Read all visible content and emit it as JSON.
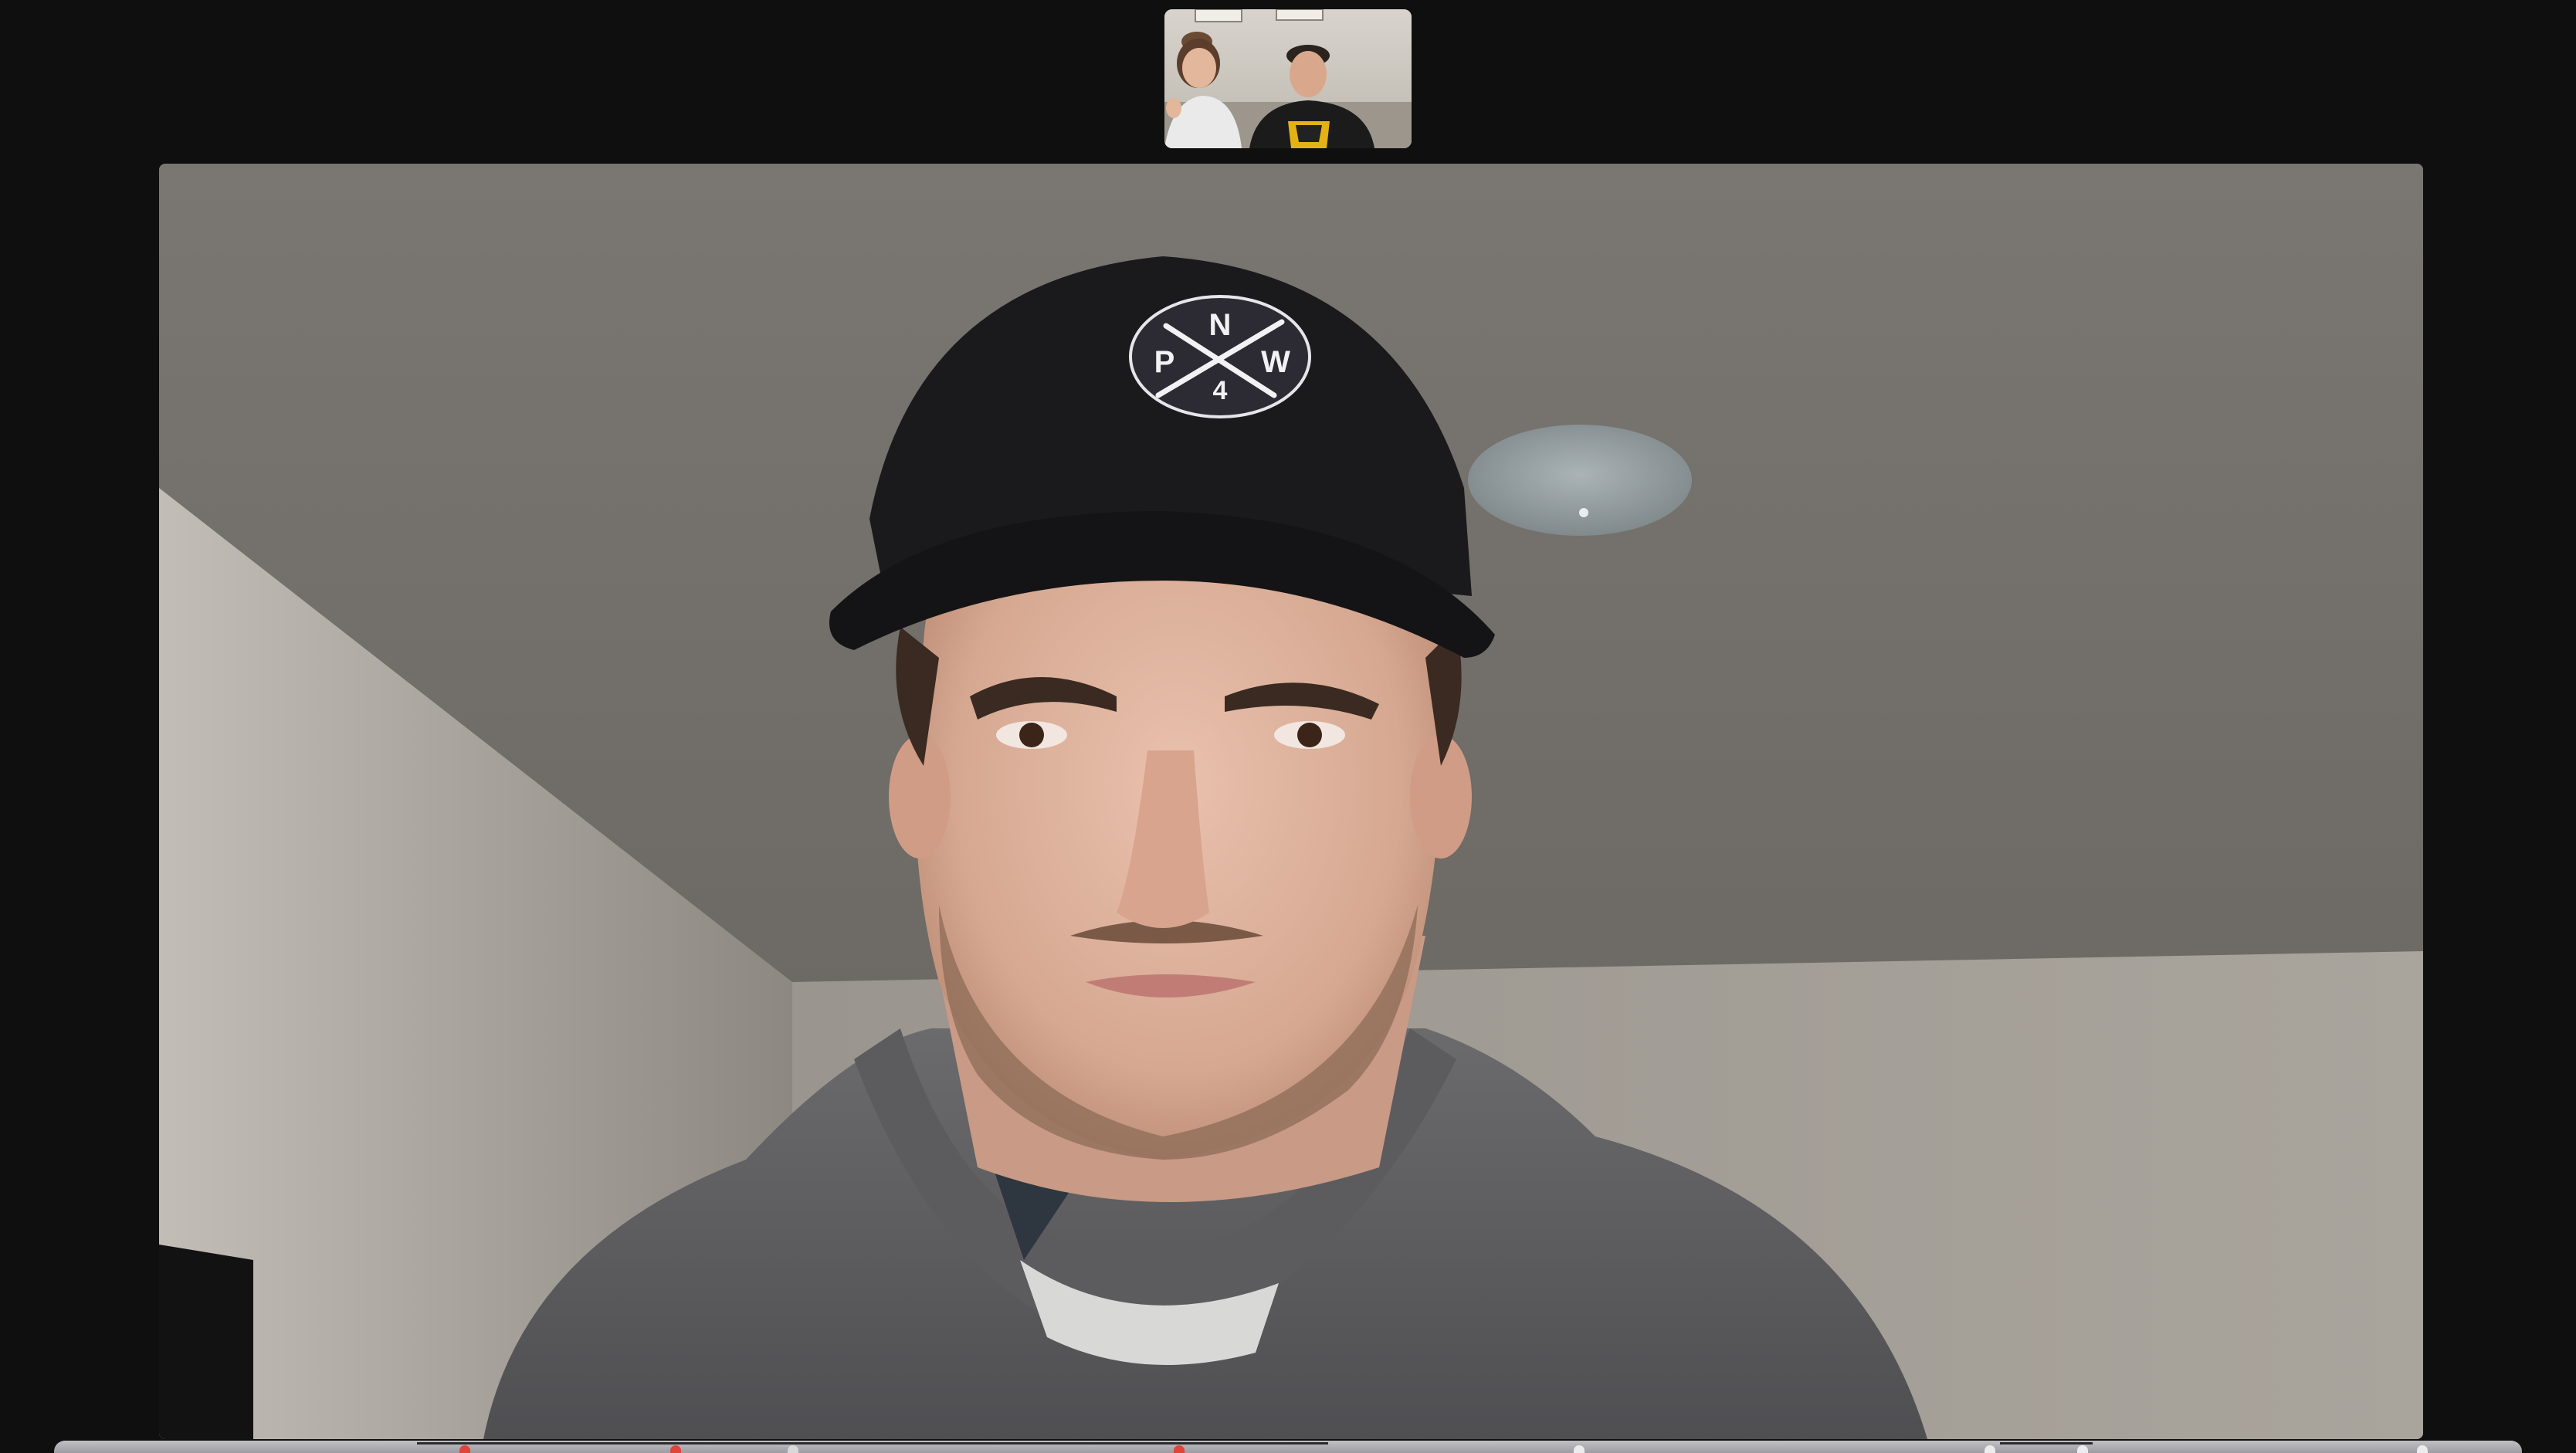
{
  "window": {
    "kind": "video-call-speaker-view"
  },
  "thumbnails": [
    {
      "participants": 2,
      "active": false
    }
  ],
  "main_speaker": {
    "cap_patch_letters": [
      "N",
      "P",
      "W",
      "4"
    ]
  },
  "dock": {
    "icons": [
      "app-icon",
      "app-icon",
      "app-icon",
      "app-icon",
      "app-icon",
      "app-icon",
      "app-icon",
      "app-icon"
    ]
  },
  "colors": {
    "background": "#0f0f0f",
    "dock": "#b3b3b8",
    "accent_red": "#e0443a"
  }
}
